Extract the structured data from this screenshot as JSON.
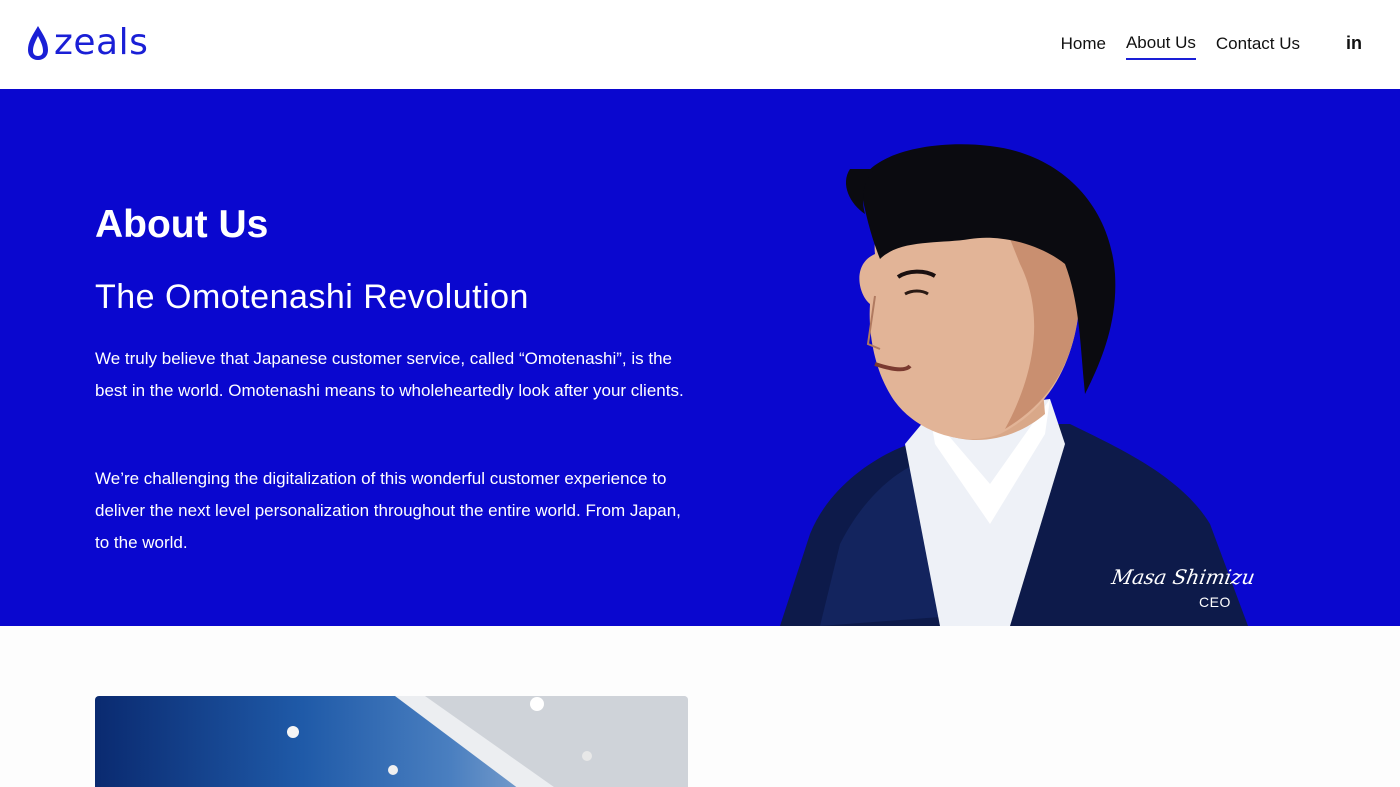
{
  "brand": {
    "logo_text": "zeals",
    "accent": "#1a1fd6",
    "hero_bg": "#0a07cf"
  },
  "nav": {
    "items": [
      {
        "label": "Home",
        "active": false
      },
      {
        "label": "About Us",
        "active": true
      },
      {
        "label": "Contact Us",
        "active": false
      }
    ],
    "social": {
      "label": "in",
      "icon": "linkedin-icon"
    }
  },
  "hero": {
    "title": "About Us",
    "subtitle": "The Omotenashi Revolution",
    "paragraph1": "We truly believe that Japanese customer service, called “Omotenashi”, is the best in the world. Omotenashi means to wholeheartedly look after your clients.",
    "paragraph2": "We’re challenging the digitalization of this wonderful customer experience to deliver the next level personalization throughout the entire world. From Japan, to the world.",
    "signature": "Masa Shimizu",
    "signature_title": "CEO"
  }
}
